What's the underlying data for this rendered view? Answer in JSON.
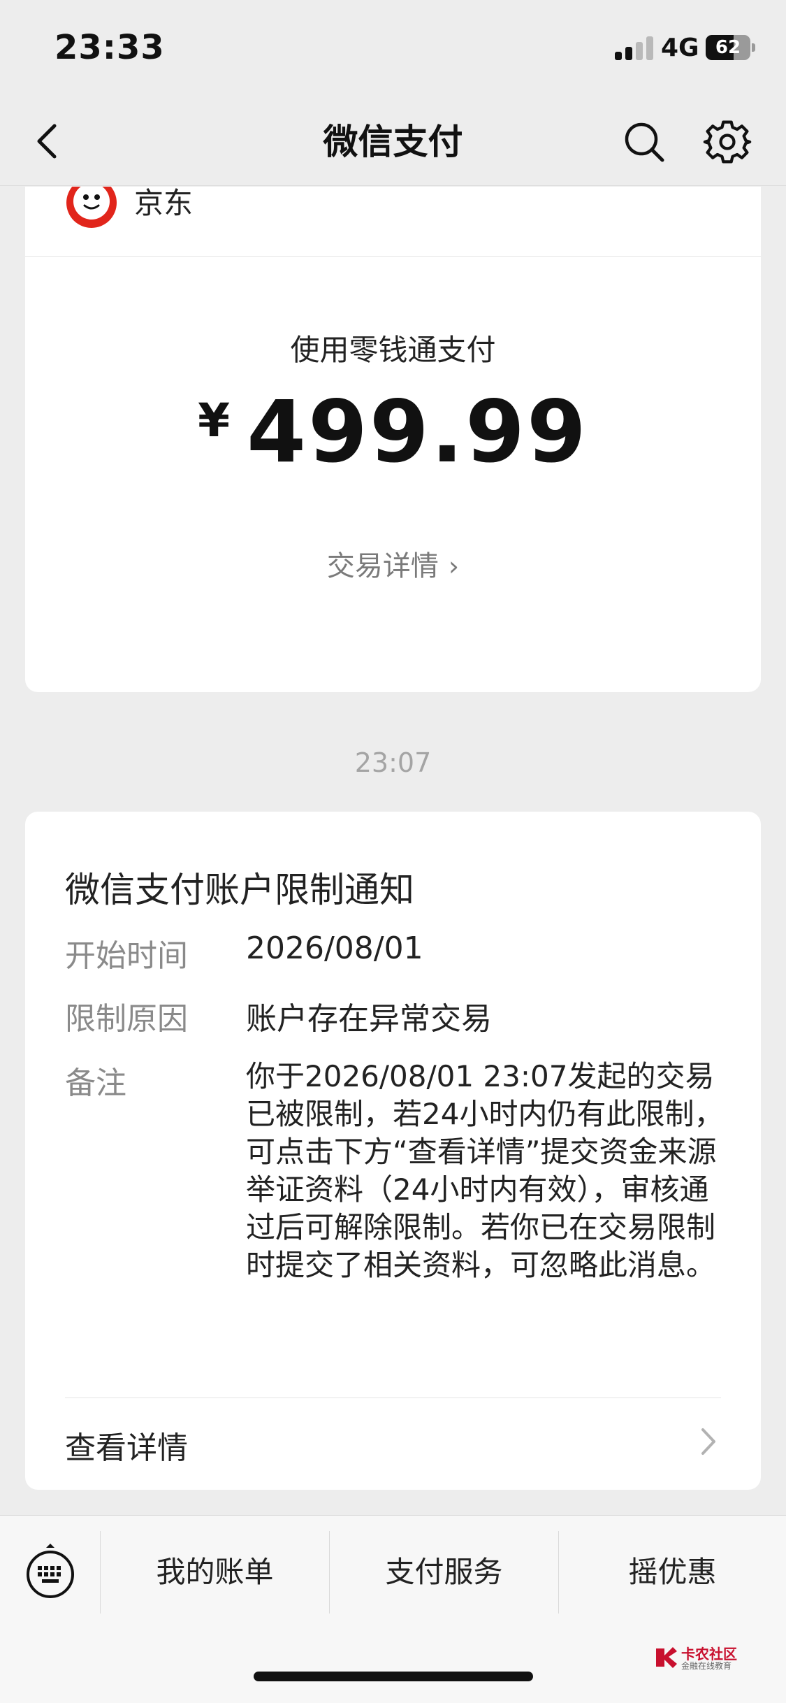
{
  "status_bar": {
    "time": "23:33",
    "network": "4G",
    "battery": "62",
    "battery_level": 0.62
  },
  "nav": {
    "title": "微信支付",
    "back_icon": "chevron-left-icon",
    "search_icon": "search-icon",
    "settings_icon": "gear-icon"
  },
  "payment_card": {
    "merchant": "京东",
    "method": "使用零钱通支付",
    "currency": "¥",
    "amount": "499.99",
    "detail_link": "交易详情",
    "chevron": "›"
  },
  "message_time": "23:07",
  "notice": {
    "title": "微信支付账户限制通知",
    "fields": [
      {
        "label": "开始时间",
        "value": "2026/08/01"
      },
      {
        "label": "限制原因",
        "value": "账户存在异常交易"
      },
      {
        "label": "备注",
        "value": "你于2026/08/01 23:07发起的交易已被限制，若24小时内仍有此限制，可点击下方“查看详情”提交资金来源举证资料（24小时内有效），审核通过后可解除限制。若你已在交易限制时提交了相关资料，可忽略此消息。"
      }
    ],
    "view_details": "查看详情"
  },
  "bottom_menu": {
    "items": [
      "我的账单",
      "支付服务",
      "摇优惠"
    ],
    "keyboard_icon": "keyboard-icon"
  },
  "watermark": {
    "name": "卡农社区",
    "sub": "金融在线教育"
  },
  "colors": {
    "background": "#ededed",
    "card": "#ffffff",
    "jd_red": "#e1251b"
  }
}
